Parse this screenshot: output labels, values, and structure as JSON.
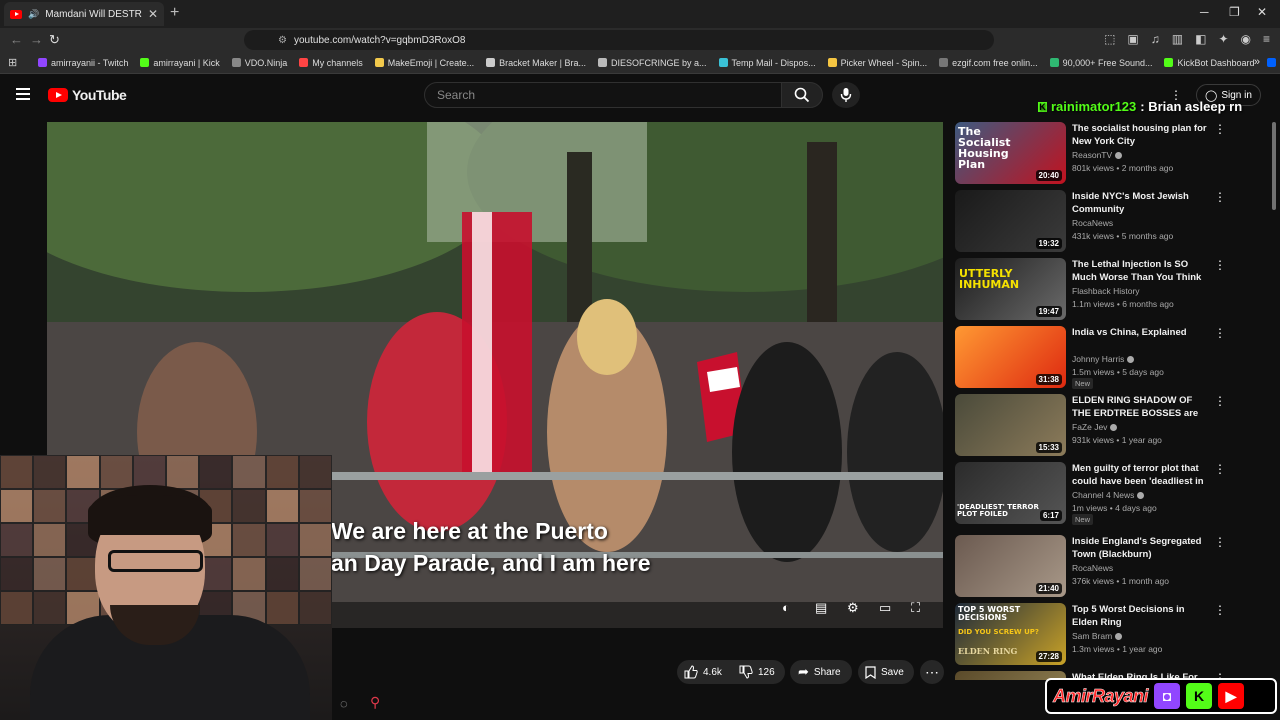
{
  "browser": {
    "tab_title": "Mamdani Will DESTROY New",
    "url": "youtube.com/watch?v=gqbmD3RoxO8",
    "bookmarks": [
      {
        "label": "amirrayanii - Twitch",
        "color": "#9146ff"
      },
      {
        "label": "amirrayani | Kick",
        "color": "#53fc18"
      },
      {
        "label": "VDO.Ninja",
        "color": "#888888"
      },
      {
        "label": "My channels",
        "color": "#ff4444"
      },
      {
        "label": "MakeEmoji | Create...",
        "color": "#f2c94c"
      },
      {
        "label": "Bracket Maker | Bra...",
        "color": "#cccccc"
      },
      {
        "label": "DIESOFCRINGE by a...",
        "color": "#bbbbbb"
      },
      {
        "label": "Temp Mail - Dispos...",
        "color": "#3ac1d6"
      },
      {
        "label": "Picker Wheel - Spin...",
        "color": "#f5c542"
      },
      {
        "label": "ezgif.com free onlin...",
        "color": "#777777"
      },
      {
        "label": "90,000+ Free Sound...",
        "color": "#2fb872"
      },
      {
        "label": "KickBot Dashboard",
        "color": "#53fc18"
      },
      {
        "label": "Dropbox",
        "color": "#0061fe"
      }
    ]
  },
  "youtube": {
    "logo_text": "YouTube",
    "search_placeholder": "Search",
    "signin_label": "Sign in"
  },
  "chat_overlay": {
    "user": "rainimator123",
    "message": ": Brian asleep rn"
  },
  "video": {
    "subtitle_line1": "We are here at the Puerto",
    "subtitle_line2": "an Day Parade, and I am here"
  },
  "actions": {
    "likes": "4.6k",
    "dislikes": "126",
    "share": "Share",
    "save": "Save"
  },
  "recommendations": [
    {
      "title": "The socialist housing plan for New York City",
      "channel": "ReasonTV",
      "verified": true,
      "meta": "801k views • 2 months ago",
      "duration": "20:40",
      "new": false,
      "thumb_text": "The Socialist Housing Plan",
      "colors": [
        "#3d5a80",
        "#c1121f"
      ]
    },
    {
      "title": "Inside NYC's Most Jewish Community",
      "channel": "RocaNews",
      "verified": false,
      "meta": "431k views • 5 months ago",
      "duration": "19:32",
      "new": false,
      "thumb_text": "",
      "colors": [
        "#1a1a1a",
        "#3b3b3b"
      ]
    },
    {
      "title": "The Lethal Injection Is SO Much Worse Than You Think",
      "channel": "Flashback History",
      "verified": false,
      "meta": "1.1m views • 6 months ago",
      "duration": "19:47",
      "new": false,
      "thumb_text": "UTTERLY INHUMAN",
      "colors": [
        "#1d1d1d",
        "#6a6a6a"
      ]
    },
    {
      "title": "India vs China, Explained",
      "channel": "Johnny Harris",
      "verified": true,
      "meta": "1.5m views • 5 days ago",
      "duration": "31:38",
      "new": true,
      "new_label": "New",
      "thumb_text": "",
      "colors": [
        "#ff9933",
        "#de2910"
      ]
    },
    {
      "title": "ELDEN RING SHADOW OF THE ERDTREE BOSSES are insanel...",
      "channel": "FaZe Jev",
      "verified": true,
      "meta": "931k views • 1 year ago",
      "duration": "15:33",
      "new": false,
      "thumb_text": "",
      "colors": [
        "#4a4a3a",
        "#8c7b5a"
      ]
    },
    {
      "title": "Men guilty of terror plot that could have been 'deadliest in ...",
      "channel": "Channel 4 News",
      "verified": true,
      "meta": "1m views • 4 days ago",
      "duration": "6:17",
      "new": true,
      "new_label": "New",
      "thumb_text": "'DEADLIEST' TERROR PLOT FOILED",
      "colors": [
        "#2b2b2b",
        "#555555"
      ]
    },
    {
      "title": "Inside England's Segregated Town (Blackburn)",
      "channel": "RocaNews",
      "verified": false,
      "meta": "376k views • 1 month ago",
      "duration": "21:40",
      "new": false,
      "thumb_text": "",
      "colors": [
        "#6b5a50",
        "#a89888"
      ]
    },
    {
      "title": "Top 5 Worst Decisions in Elden Ring",
      "channel": "Sam Bram",
      "verified": true,
      "meta": "1.3m views • 1 year ago",
      "duration": "27:28",
      "new": false,
      "thumb_text": "TOP 5 WORST DECISIONS",
      "thumb_text2": "DID YOU SCREW UP?",
      "thumb_text3": "ELDEN RING",
      "colors": [
        "#1e2a3a",
        "#c9a227"
      ]
    },
    {
      "title": "What Elden Ring Is Like For...",
      "channel": "",
      "verified": false,
      "meta": "",
      "duration": "",
      "new": false,
      "thumb_text": "",
      "colors": [
        "#5a4a2a",
        "#9a8a5a"
      ]
    }
  ],
  "branding": {
    "name": "AmirRayani"
  },
  "colors": {
    "accent_red": "#ff0000",
    "kick_green": "#53fc18",
    "page_bg": "#0f0f0f"
  }
}
